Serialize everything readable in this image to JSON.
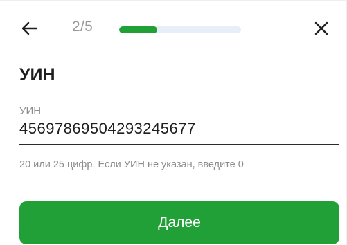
{
  "header": {
    "step_counter": "2/5",
    "progress_fraction": 0.31,
    "back_icon": "arrow-left-icon",
    "close_icon": "close-icon"
  },
  "main": {
    "title": "УИН",
    "field": {
      "label": "УИН",
      "value": "45697869504293245677"
    },
    "hint": "20 или 25 цифр. Если УИН не указан, введите 0",
    "next_button_label": "Далее"
  },
  "colors": {
    "accent": "#21a038",
    "progress_track": "#e8eef7",
    "muted_text": "#8c8c8c",
    "step_text": "#9a9a9a"
  }
}
